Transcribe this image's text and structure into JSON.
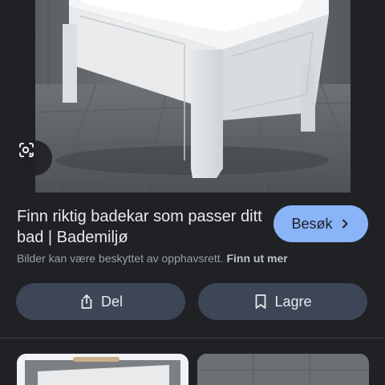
{
  "result": {
    "title": "Finn riktig badekar som passer ditt bad | Bademiljø",
    "visit_label": "Besøk",
    "copyright_text": "Bilder kan være beskyttet av opphavsrett.",
    "learn_more": "Finn ut mer"
  },
  "actions": {
    "share_label": "Del",
    "save_label": "Lagre"
  },
  "colors": {
    "background": "#202124",
    "visit_button": "#8ab4f8",
    "action_button": "#3c4656"
  },
  "icons": [
    "lens-icon",
    "chevron-right-icon",
    "share-icon",
    "bookmark-icon"
  ]
}
